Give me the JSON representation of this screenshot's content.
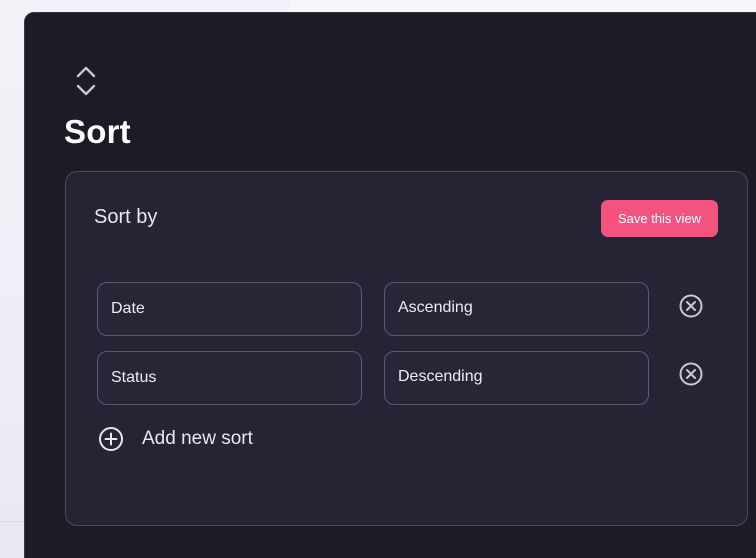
{
  "dialog": {
    "title": "Sort",
    "sort_by_label": "Sort by",
    "save_label": "Save this view",
    "add_label": "Add new sort",
    "rows": [
      {
        "field": "Date",
        "order": "Ascending"
      },
      {
        "field": "Status",
        "order": "Descending"
      }
    ]
  },
  "icons": {
    "header": "sort-chevrons-icon",
    "remove": "close-circle-icon",
    "add": "plus-circle-icon"
  },
  "colors": {
    "panel_bg": "#1c1b26",
    "card_bg": "#252434",
    "accent": "#f2547f",
    "border": "#5b577a",
    "icon": "#c9c6d8"
  }
}
